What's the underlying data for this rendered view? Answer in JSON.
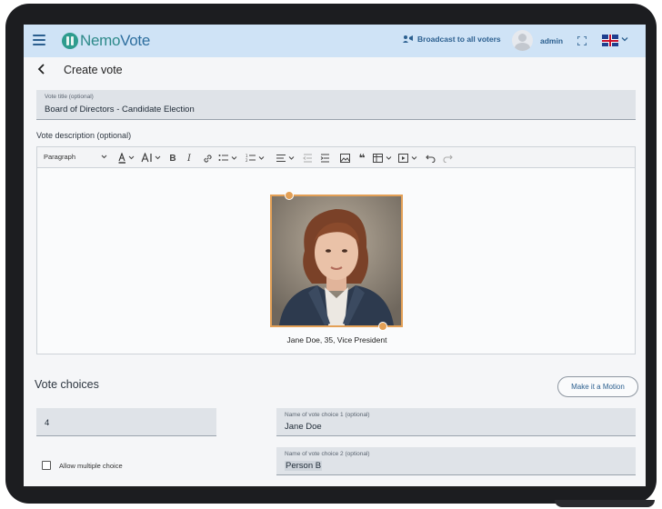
{
  "header": {
    "logo_text_a": "Nemo",
    "logo_text_b": "Vote",
    "broadcast_label": "Broadcast to all voters",
    "user_name": "admin"
  },
  "page": {
    "title": "Create vote"
  },
  "vote_title": {
    "label": "Vote title (optional)",
    "value": "Board of Directors - Candidate Election"
  },
  "description": {
    "label": "Vote description (optional)",
    "toolbar": {
      "paragraph": "Paragraph"
    },
    "image_caption": "Jane Doe, 35, Vice President"
  },
  "choices": {
    "title": "Vote choices",
    "motion_button": "Make it a Motion",
    "count_value": "4",
    "allow_multiple_label": "Allow multiple choice",
    "items": [
      {
        "label": "Name of vote choice 1 (optional)",
        "value": "Jane Doe"
      },
      {
        "label": "Name of vote choice 2 (optional)",
        "value": "Person B"
      }
    ]
  },
  "colors": {
    "appbar": "#cfe3f6",
    "accent": "#2b5f8f",
    "image_border": "#e3a056"
  }
}
